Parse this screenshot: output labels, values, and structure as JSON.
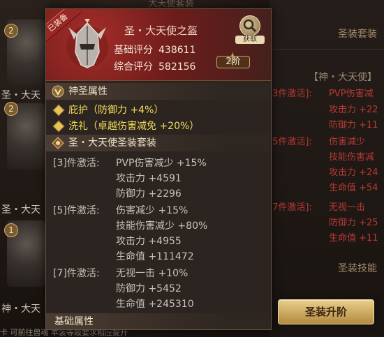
{
  "background": {
    "top_title": "大天使套装",
    "left_badges": [
      "2",
      "2",
      "1"
    ],
    "left_texts": [
      "圣・大天",
      "圣・大天",
      "神・大天"
    ],
    "right_header_1": "圣装套装",
    "right_header_2": "【神・大天使】",
    "right_header_3": "圣装技能",
    "right_rows": [
      {
        "left": "[3件激活]:",
        "right": "PVP伤害减"
      },
      {
        "left": "",
        "right": "攻击力 +22"
      },
      {
        "left": "",
        "right": "防御力 +11"
      },
      {
        "left": "[5件激活]:",
        "right": "伤害减少"
      },
      {
        "left": "",
        "right": "技能伤害减"
      },
      {
        "left": "",
        "right": "攻击力 +24"
      },
      {
        "left": "",
        "right": "生命值 +54"
      },
      {
        "left": "[7件激活]:",
        "right": "无视一击"
      },
      {
        "left": "",
        "right": "防御力 +25"
      },
      {
        "left": "",
        "right": "生命值 +11"
      }
    ],
    "upgrade_button": "圣装升阶",
    "bottom_note": "卡 可前往兽魂 本装等级要求相应提升"
  },
  "tooltip": {
    "equipped_tag": "已装备",
    "item_name": "圣・大天使之盔",
    "base_score_label": "基础评分",
    "base_score_value": "438611",
    "total_score_label": "综合评分",
    "total_score_value": "582156",
    "source_label": "获取",
    "grade_label": "2阶",
    "holy_section_title": "神圣属性",
    "holy_attrs": [
      "庇护（防御力 +4%）",
      "洗礼（卓越伤害减免 +20%）"
    ],
    "set_section_title": "圣・大天使圣装套装",
    "set_rows": [
      {
        "activation": "[3]件激活:",
        "effect": "PVP伤害减少 +15%"
      },
      {
        "activation": "",
        "effect": "攻击力 +4591"
      },
      {
        "activation": "",
        "effect": "防御力 +2296"
      },
      {
        "activation": "[5]件激活:",
        "effect": "伤害减少 +15%"
      },
      {
        "activation": "",
        "effect": "技能伤害减少 +80%"
      },
      {
        "activation": "",
        "effect": "攻击力 +4955"
      },
      {
        "activation": "",
        "effect": "生命值 +111472"
      },
      {
        "activation": "[7]件激活:",
        "effect": "无视一击 +10%"
      },
      {
        "activation": "",
        "effect": "防御力 +5452"
      },
      {
        "activation": "",
        "effect": "生命值 +245310"
      }
    ],
    "base_section_title": "基础属性"
  },
  "colors": {
    "accent_gold": "#d4b06a",
    "holy_text": "#f3de58",
    "set_text": "#c9c0b8",
    "header_red": "#a52d28",
    "inactive_red": "#b63a33"
  },
  "icons": {
    "helmet": "helmet-icon",
    "source": "magnifier-icon",
    "grade": "star-icon",
    "holy": "holy-emblem-icon",
    "set": "set-emblem-icon",
    "bullet": "diamond-bullet-icon"
  }
}
